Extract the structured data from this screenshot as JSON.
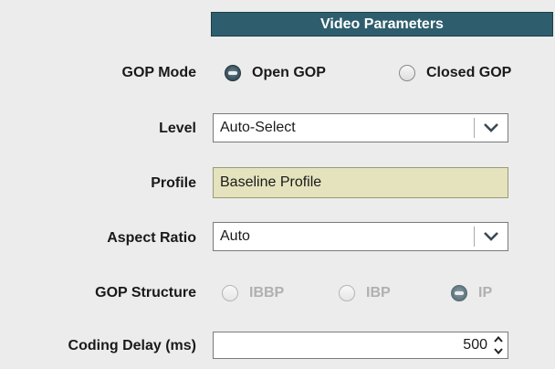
{
  "header": {
    "title": "Video Parameters"
  },
  "gop_mode": {
    "label": "GOP Mode",
    "options": [
      {
        "label": "Open GOP",
        "selected": true
      },
      {
        "label": "Closed GOP",
        "selected": false
      }
    ]
  },
  "level": {
    "label": "Level",
    "value": "Auto-Select"
  },
  "profile": {
    "label": "Profile",
    "value": "Baseline Profile"
  },
  "aspect_ratio": {
    "label": "Aspect Ratio",
    "value": "Auto"
  },
  "gop_structure": {
    "label": "GOP Structure",
    "enabled": false,
    "options": [
      {
        "label": "IBBP",
        "selected": false
      },
      {
        "label": "IBP",
        "selected": false
      },
      {
        "label": "IP",
        "selected": true
      }
    ]
  },
  "coding_delay": {
    "label": "Coding Delay (ms)",
    "value": "500"
  },
  "colors": {
    "header_bg": "#2e5e6e",
    "profile_bg": "#e5e3bd",
    "background": "#ececec"
  }
}
